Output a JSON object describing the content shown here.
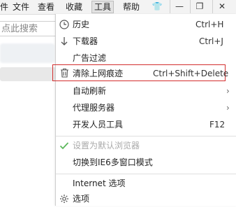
{
  "menubar": {
    "items": [
      {
        "label": "件"
      },
      {
        "label": "文件"
      },
      {
        "label": "查看"
      },
      {
        "label": "收藏"
      },
      {
        "label": "工具"
      },
      {
        "label": "帮助"
      }
    ],
    "controls": {
      "shirt": "👕",
      "minimize": "—",
      "restore": "❐",
      "close": "✕"
    }
  },
  "search": {
    "placeholder": "点此搜索"
  },
  "tools_menu": {
    "items": [
      {
        "label": "历史",
        "shortcut": "Ctrl+H",
        "icon": "clock-icon"
      },
      {
        "label": "下载器",
        "shortcut": "Ctrl+J",
        "icon": "download-icon"
      },
      {
        "label": "广告过滤"
      },
      {
        "label": "清除上网痕迹",
        "shortcut": "Ctrl+Shift+Delete",
        "icon": "trash-icon"
      },
      {
        "label": "自动刷新"
      },
      {
        "label": "代理服务器"
      },
      {
        "label": "开发人员工具",
        "shortcut": "F12"
      },
      {
        "label": "设置为默认浏览器",
        "icon": "check-icon"
      },
      {
        "label": "切换到IE6多窗口模式"
      },
      {
        "label": "Internet 选项"
      },
      {
        "label": "选项",
        "icon": "gear-icon"
      }
    ]
  },
  "colors": {
    "highlight_border": "#d32f2f",
    "check": "#5cb85c"
  }
}
